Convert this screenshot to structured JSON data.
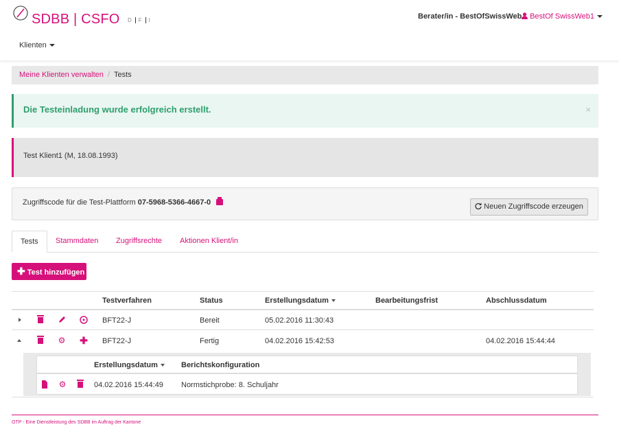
{
  "header": {
    "logo_text": "SDBB | CSFO",
    "languages": [
      "D",
      "F",
      "I"
    ],
    "role": "Berater/in - BestOfSwissWeb",
    "user": "BestOf SwissWeb1",
    "nav_klienten": "Klienten"
  },
  "breadcrumb": {
    "parent": "Meine Klienten verwalten",
    "separator": "/",
    "current": "Tests"
  },
  "alert": {
    "message": "Die Testeinladung wurde erfolgreich erstellt.",
    "close": "×"
  },
  "client": {
    "label": "Test Klient1 (M, 18.08.1993)"
  },
  "access": {
    "prefix": "Zugriffscode für die Test-Plattform",
    "code": "07-5968-5366-4667-0",
    "regen_button": "Neuen Zugriffscode erzeugen"
  },
  "tabs": [
    "Tests",
    "Stammdaten",
    "Zugriffsrechte",
    "Aktionen Klient/in"
  ],
  "add_button": "Test hinzufügen",
  "table": {
    "columns": [
      "Testverfahren",
      "Status",
      "Erstellungsdatum",
      "Bearbeitungsfrist",
      "Abschlussdatum"
    ],
    "rows": [
      {
        "verfahren": "BFT22-J",
        "status": "Bereit",
        "erstellung": "05.02.2016 11:30:43",
        "frist": "",
        "abschluss": ""
      },
      {
        "verfahren": "BFT22-J",
        "status": "Fertig",
        "erstellung": "04.02.2016 15:42:53",
        "frist": "",
        "abschluss": "04.02.2016 15:44:44"
      }
    ]
  },
  "subtable": {
    "columns": [
      "Erstellungsdatum",
      "Berichtskonfiguration"
    ],
    "rows": [
      {
        "erstellung": "04.02.2016 15:44:49",
        "konfiguration": "Normstichprobe: 8. Schuljahr"
      }
    ]
  },
  "footer": "OTP - Eine Dienstleistung des SDBB im Auftrag der Kantone",
  "colors": {
    "accent": "#d6107a",
    "success": "#2e9e6e"
  }
}
